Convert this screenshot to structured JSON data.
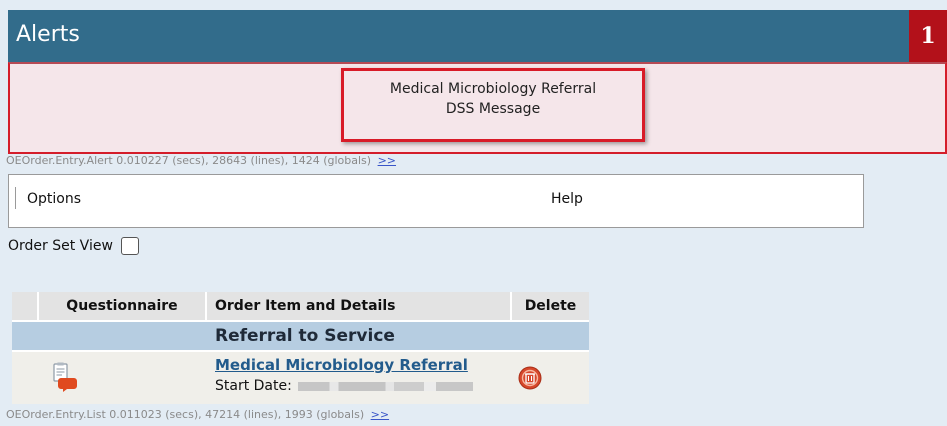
{
  "alerts": {
    "title": "Alerts",
    "count": "1",
    "message_line1": "Medical Microbiology Referral",
    "message_line2": "DSS Message"
  },
  "perf_alert": {
    "text": "OEOrder.Entry.Alert  0.010227 (secs),  28643 (lines),  1424 (globals)",
    "more": ">>"
  },
  "menu": {
    "options": "Options",
    "help": "Help"
  },
  "order_set_view": {
    "label": "Order Set View",
    "checked": false
  },
  "table": {
    "headers": {
      "questionnaire": "Questionnaire",
      "order_item": "Order Item and Details",
      "delete": "Delete"
    },
    "group_label": "Referral to Service",
    "rows": [
      {
        "item_name": "Medical Microbiology Referral",
        "start_label": "Start Date:",
        "questionnaire_icon": "questionnaire-icon",
        "delete_icon": "delete-icon"
      }
    ]
  },
  "perf_list": {
    "text": "OEOrder.Entry.List  0.011023 (secs),  47214 (lines),  1993 (globals)",
    "more": ">>"
  },
  "colors": {
    "header_bg": "#326c8b",
    "alert_count_bg": "#b3111a",
    "alert_border": "#d81b28",
    "group_row_bg": "#b6cde1",
    "link": "#225b8c"
  }
}
